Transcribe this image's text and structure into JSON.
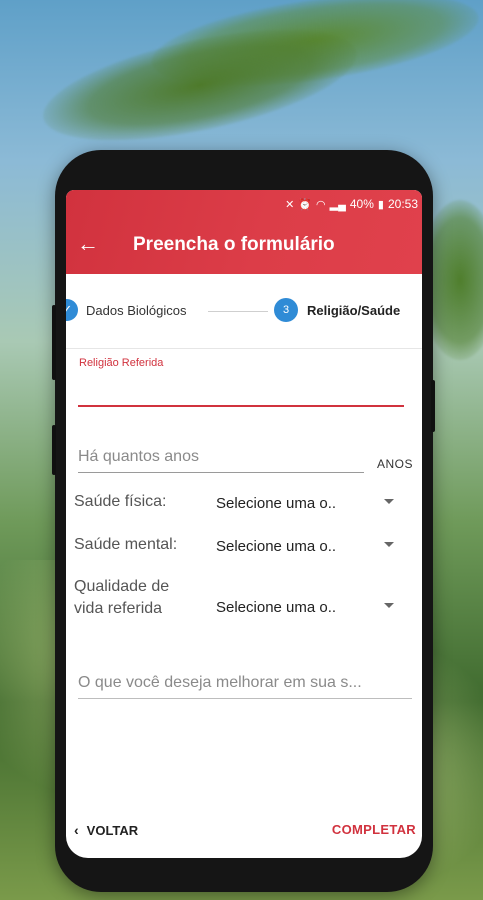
{
  "status_bar": {
    "battery_percent": "40%",
    "time": "20:53",
    "icons": [
      "mute-icon",
      "alarm-icon",
      "wifi-icon",
      "signal-icon",
      "battery-icon"
    ]
  },
  "app_bar": {
    "title": "Preencha o formulário",
    "back_icon": "arrow-left-icon",
    "color": "#d1323e"
  },
  "stepper": {
    "steps": [
      {
        "label": "Dados Biológicos",
        "state": "completed"
      },
      {
        "label": "Religião/Saúde",
        "number": "3",
        "state": "active"
      }
    ],
    "active_color": "#2f8bd6"
  },
  "form": {
    "religion": {
      "label": "Religião Referida",
      "value": ""
    },
    "years": {
      "placeholder": "Há quantos anos",
      "suffix": "ANOS"
    },
    "physical_health": {
      "label": "Saúde física:",
      "value": "Selecione uma o.."
    },
    "mental_health": {
      "label": "Saúde mental:",
      "value": "Selecione uma o.."
    },
    "quality_of_life": {
      "label_line1": "Qualidade de",
      "label_line2": "vida referida",
      "value": "Selecione uma o.."
    },
    "improve": {
      "placeholder": "O que você deseja melhorar em sua s..."
    }
  },
  "footer": {
    "back_label": "VOLTAR",
    "complete_label": "COMPLETAR"
  }
}
